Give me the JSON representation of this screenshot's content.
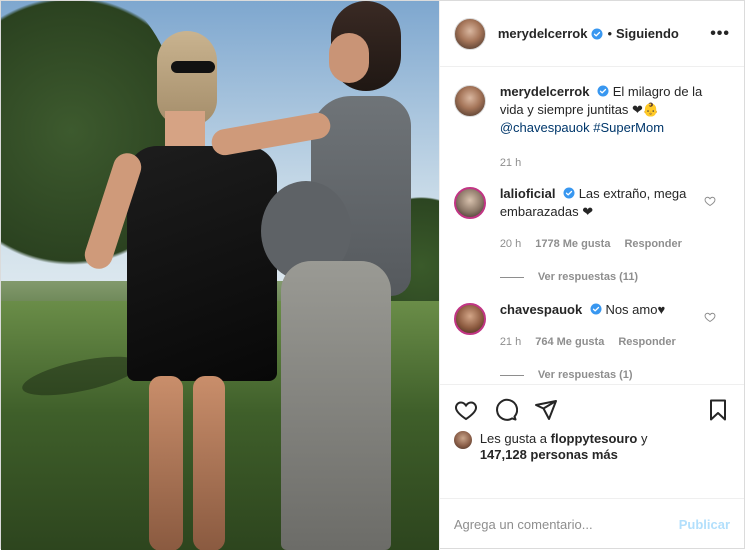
{
  "header": {
    "username": "merydelcerrok",
    "separator": "•",
    "follow_status": "Siguiendo",
    "more": "•••"
  },
  "caption": {
    "username": "merydelcerrok",
    "text": "El milagro de la vida y siempre juntitas ❤👶",
    "mention": "@chavespauok",
    "hashtag": "#SuperMom",
    "time": "21 h"
  },
  "comments": [
    {
      "username": "lalioficial",
      "text": "Las extraño, mega embarazadas ❤",
      "time": "20 h",
      "likes": "1778 Me gusta",
      "reply": "Responder",
      "view_replies": "Ver respuestas (11)"
    },
    {
      "username": "chavespauok",
      "text": "Nos amo♥",
      "time": "21 h",
      "likes": "764 Me gusta",
      "reply": "Responder",
      "view_replies": "Ver respuestas (1)"
    }
  ],
  "likes": {
    "prefix": "Les gusta a",
    "user": "floppytesouro",
    "conjunction": "y",
    "count": "147,128 personas más"
  },
  "add_comment": {
    "placeholder": "Agrega un comentario...",
    "publish": "Publicar"
  },
  "colors": {
    "link": "#00376b",
    "verified": "#3897f0",
    "muted": "#8e8e8e",
    "publish_disabled": "#b2dffc"
  },
  "icons": [
    "heart-icon",
    "comment-icon",
    "share-icon",
    "bookmark-icon",
    "verified-badge-icon",
    "more-options-icon"
  ]
}
